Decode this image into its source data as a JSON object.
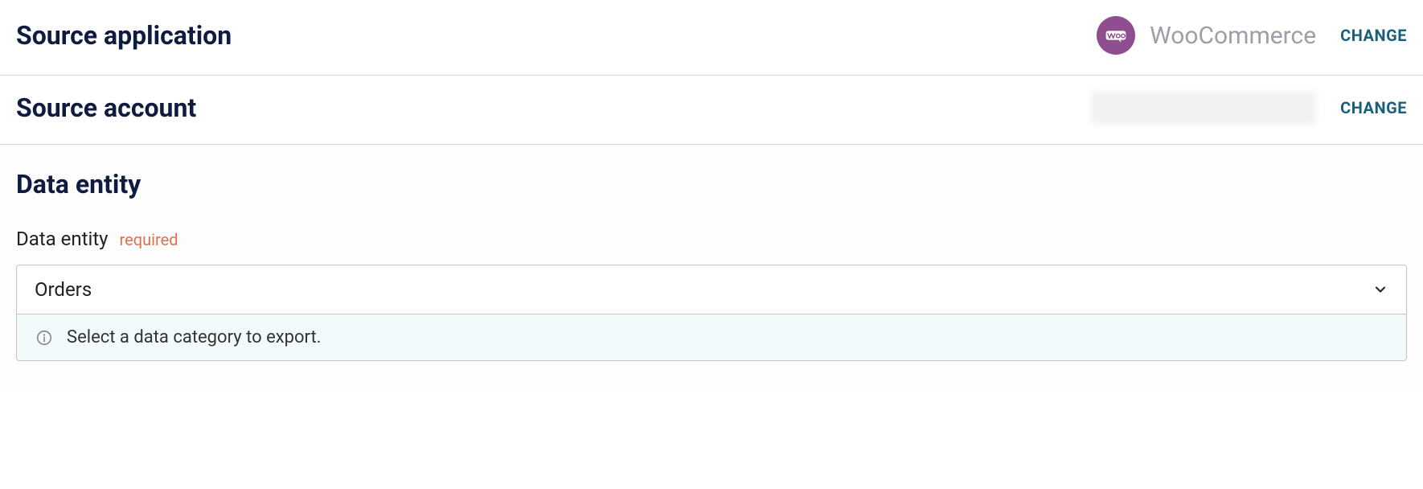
{
  "source_app": {
    "title": "Source application",
    "app_name": "WooCommerce",
    "change_label": "CHANGE"
  },
  "source_account": {
    "title": "Source account",
    "change_label": "CHANGE"
  },
  "data_entity": {
    "heading": "Data entity",
    "field_label": "Data entity",
    "required_tag": "required",
    "selected_value": "Orders",
    "info_text": "Select a data category to export."
  },
  "icons": {
    "woo": "woo-icon",
    "chevron_down": "chevron-down-icon",
    "info": "info-icon"
  },
  "colors": {
    "brand_woo": "#8f4f8f",
    "link": "#1a5e7a",
    "required": "#e2704d",
    "dark_text": "#0f1c3f",
    "info_bg": "#f3fafb"
  }
}
